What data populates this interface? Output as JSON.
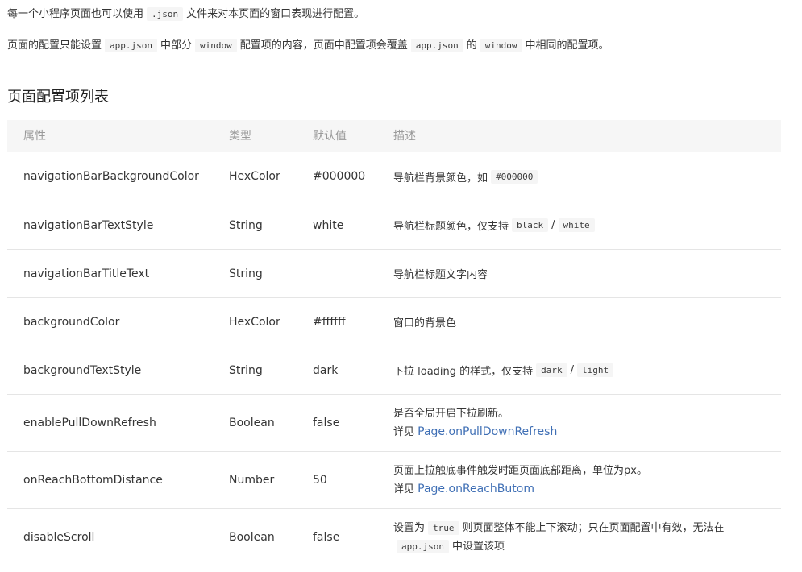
{
  "intro": {
    "p1_text1": "每一个小程序页面也可以使用",
    "p1_code": ".json",
    "p1_text2": "文件来对本页面的窗口表现进行配置。",
    "p2_text1": "页面的配置只能设置",
    "p2_code1": "app.json",
    "p2_text2": "中部分",
    "p2_code2": "window",
    "p2_text3": "配置项的内容，页面中配置项会覆盖",
    "p2_code3": "app.json",
    "p2_text4": "的",
    "p2_code4": "window",
    "p2_text5": "中相同的配置项。"
  },
  "section_title": "页面配置项列表",
  "table": {
    "headers": {
      "attr": "属性",
      "type": "类型",
      "default": "默认值",
      "desc": "描述"
    },
    "rows": [
      {
        "attr": "navigationBarBackgroundColor",
        "type": "HexColor",
        "default": "#000000",
        "desc1": "导航栏背景颜色，如",
        "code1": "#000000"
      },
      {
        "attr": "navigationBarTextStyle",
        "type": "String",
        "default": "white",
        "desc1": "导航栏标题颜色，仅支持",
        "code1": "black",
        "sep": "/",
        "code2": "white"
      },
      {
        "attr": "navigationBarTitleText",
        "type": "String",
        "default": "",
        "desc1": "导航栏标题文字内容"
      },
      {
        "attr": "backgroundColor",
        "type": "HexColor",
        "default": "#ffffff",
        "desc1": "窗口的背景色"
      },
      {
        "attr": "backgroundTextStyle",
        "type": "String",
        "default": "dark",
        "desc1": "下拉 loading 的样式，仅支持",
        "code1": "dark",
        "sep": "/",
        "code2": "light"
      },
      {
        "attr": "enablePullDownRefresh",
        "type": "Boolean",
        "default": "false",
        "desc1": "是否全局开启下拉刷新。",
        "see": "详见",
        "link": "Page.onPullDownRefresh"
      },
      {
        "attr": "onReachBottomDistance",
        "type": "Number",
        "default": "50",
        "desc1": "页面上拉触底事件触发时距页面底部距离，单位为px。",
        "see": "详见",
        "link": "Page.onReachButom"
      },
      {
        "attr": "disableScroll",
        "type": "Boolean",
        "default": "false",
        "desc_pre": "设置为",
        "code1": "true",
        "desc1": "则页面整体不能上下滚动；只在页面配置中有效，无法在",
        "code2": "app.json",
        "desc2": "中设置该项"
      }
    ]
  },
  "colors": {
    "link": "#3f6fb5",
    "header_bg": "#f6f6f6",
    "code_bg": "#f5f5f5",
    "border": "#e5e5e5"
  }
}
